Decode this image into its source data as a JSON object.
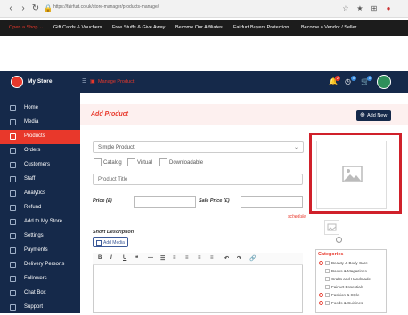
{
  "browser": {
    "url": "https://fairfurt.co.uk/store-manager/products-manage/"
  },
  "promo_bar": {
    "items": [
      "Open a Shop ⌄",
      "Gift Cards & Vouchers",
      "Free Stuffs & Give Away",
      "Become Our Affiliates",
      "Fairfurt Buyers Protection",
      "Become a Vendor / Seller"
    ]
  },
  "header": {
    "store_name": "My Store",
    "breadcrumb": "Manage Product",
    "notifications": [
      "2",
      "0",
      "0"
    ]
  },
  "sidebar": {
    "items": [
      {
        "label": "Home",
        "icon": "home-icon"
      },
      {
        "label": "Media",
        "icon": "media-icon"
      },
      {
        "label": "Products",
        "icon": "products-icon",
        "active": true
      },
      {
        "label": "Orders",
        "icon": "orders-icon"
      },
      {
        "label": "Customers",
        "icon": "customers-icon"
      },
      {
        "label": "Staff",
        "icon": "staff-icon"
      },
      {
        "label": "Analytics",
        "icon": "analytics-icon"
      },
      {
        "label": "Refund",
        "icon": "refund-icon"
      },
      {
        "label": "Add to My Store",
        "icon": "add-store-icon"
      },
      {
        "label": "Settings",
        "icon": "settings-icon"
      },
      {
        "label": "Payments",
        "icon": "payments-icon"
      },
      {
        "label": "Delivery Persons",
        "icon": "delivery-icon"
      },
      {
        "label": "Followers",
        "icon": "followers-icon"
      },
      {
        "label": "Chat Box",
        "icon": "chat-icon"
      },
      {
        "label": "Support",
        "icon": "support-icon"
      }
    ]
  },
  "page": {
    "title": "Add Product",
    "add_new": "Add New"
  },
  "form": {
    "product_type": "Simple Product",
    "options": [
      "Catalog",
      "Virtual",
      "Downloadable"
    ],
    "title_placeholder": "Product Title",
    "price_label": "Price (£)",
    "sale_price_label": "Sale Price (£)",
    "schedule": "schedule",
    "short_description": "Short Description",
    "add_media": "Add Media"
  },
  "editor_toolbar": [
    "B",
    "I",
    "U",
    "❝",
    "—",
    "☰",
    "≡",
    "≡",
    "≡",
    "≡",
    "↶",
    "↷",
    "🔗"
  ],
  "categories": {
    "label": "Categories",
    "items": [
      {
        "label": "Beauty & Body Care",
        "expandable": true
      },
      {
        "label": "Books & Magazines",
        "expandable": false
      },
      {
        "label": "Crafts and Handmade",
        "expandable": false
      },
      {
        "label": "Fairfurt Essentials",
        "expandable": false
      },
      {
        "label": "Fashion & Style",
        "expandable": true
      },
      {
        "label": "Foods & Cuisines",
        "expandable": true
      }
    ]
  },
  "colors": {
    "navy": "#15294a",
    "accent": "#e8382b",
    "highlight": "#d0202a"
  }
}
